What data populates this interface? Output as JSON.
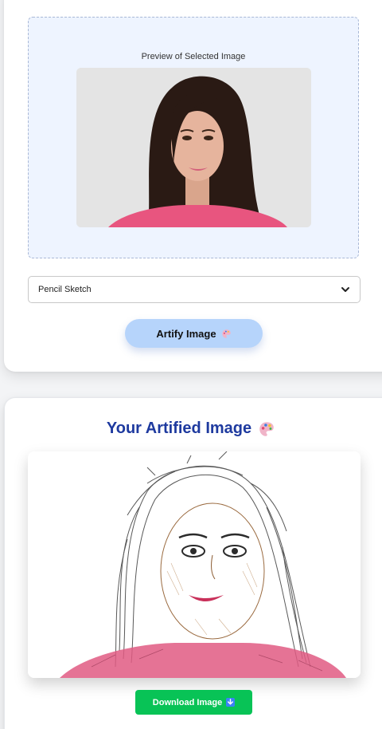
{
  "upload": {
    "preview_label": "Preview of Selected Image"
  },
  "style_select": {
    "value": "Pencil Sketch"
  },
  "artify_button": {
    "label": "Artify Image",
    "icon": "palette-icon"
  },
  "result": {
    "title": "Your Artified Image",
    "title_icon": "palette-icon"
  },
  "download_button": {
    "label": "Download Image",
    "icon": "down-arrow-icon"
  },
  "colors": {
    "accent_blue": "#b6d4fb",
    "title_blue": "#1e3a9f",
    "download_green": "#08c356",
    "dropzone_bg": "#eef4ff"
  }
}
